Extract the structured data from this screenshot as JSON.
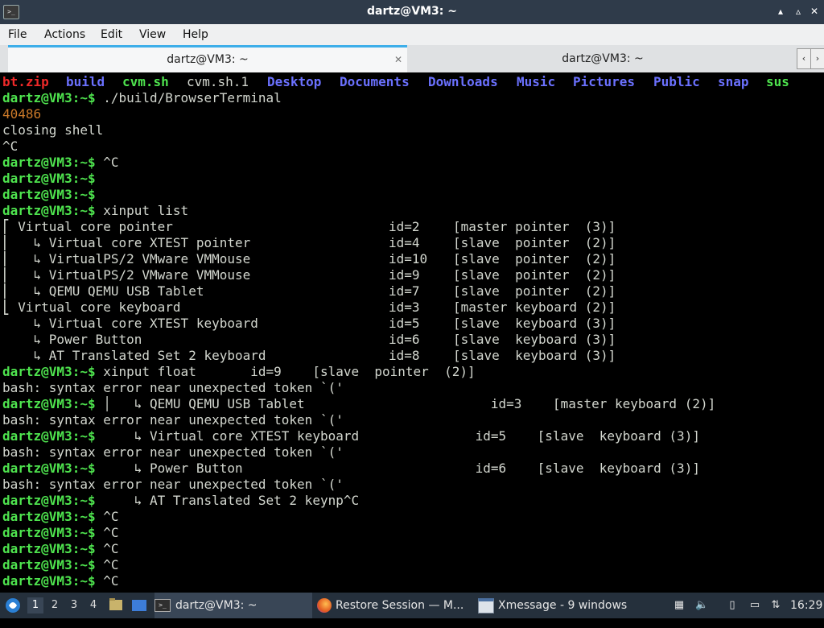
{
  "window": {
    "title": "dartz@VM3: ~",
    "minimize_glyph": "▴",
    "maximize_glyph": "▵",
    "close_glyph": "✕"
  },
  "menu": [
    "File",
    "Actions",
    "Edit",
    "View",
    "Help"
  ],
  "tabs": [
    {
      "label": "dartz@VM3: ~",
      "active": true,
      "close": "✕"
    },
    {
      "label": "dartz@VM3: ~",
      "active": false
    }
  ],
  "tab_nav": {
    "left": "‹",
    "right": "›"
  },
  "terminal": {
    "prompt": "dartz@VM3:~$",
    "ls_items": [
      {
        "text": "bt.zip",
        "color": "red"
      },
      {
        "text": "build",
        "color": "blue"
      },
      {
        "text": "cvm.sh",
        "color": "green"
      },
      {
        "text": "cvm.sh.1",
        "color": "white"
      },
      {
        "text": "Desktop",
        "color": "blue"
      },
      {
        "text": "Documents",
        "color": "blue"
      },
      {
        "text": "Downloads",
        "color": "blue"
      },
      {
        "text": "Music",
        "color": "blue"
      },
      {
        "text": "Pictures",
        "color": "blue"
      },
      {
        "text": "Public",
        "color": "blue"
      },
      {
        "text": "snap",
        "color": "blue"
      },
      {
        "text": "sus",
        "color": "green"
      }
    ],
    "lines": [
      {
        "prompt": true,
        "text": " ./build/BrowserTerminal"
      },
      {
        "prompt": false,
        "text": "40486",
        "color": "orange"
      },
      {
        "prompt": false,
        "text": "closing shell"
      },
      {
        "prompt": false,
        "text": "^C"
      },
      {
        "prompt": true,
        "text": " ^C"
      },
      {
        "prompt": true,
        "text": ""
      },
      {
        "prompt": true,
        "text": ""
      },
      {
        "prompt": true,
        "text": " xinput list"
      },
      {
        "prompt": false,
        "text": "⎡ Virtual core pointer                    \tid=2\t[master pointer  (3)]"
      },
      {
        "prompt": false,
        "text": "⎜   ↳ Virtual core XTEST pointer              \tid=4\t[slave  pointer  (2)]"
      },
      {
        "prompt": false,
        "text": "⎜   ↳ VirtualPS/2 VMware VMMouse              \tid=10\t[slave  pointer  (2)]"
      },
      {
        "prompt": false,
        "text": "⎜   ↳ VirtualPS/2 VMware VMMouse              \tid=9\t[slave  pointer  (2)]"
      },
      {
        "prompt": false,
        "text": "⎜   ↳ QEMU QEMU USB Tablet                    \tid=7\t[slave  pointer  (2)]"
      },
      {
        "prompt": false,
        "text": "⎣ Virtual core keyboard                   \tid=3\t[master keyboard (2)]"
      },
      {
        "prompt": false,
        "text": "    ↳ Virtual core XTEST keyboard             \tid=5\t[slave  keyboard (3)]"
      },
      {
        "prompt": false,
        "text": "    ↳ Power Button                            \tid=6\t[slave  keyboard (3)]"
      },
      {
        "prompt": false,
        "text": "    ↳ AT Translated Set 2 keyboard            \tid=8\t[slave  keyboard (3)]"
      },
      {
        "prompt": true,
        "text": " xinput float       id=9    [slave  pointer  (2)]"
      },
      {
        "prompt": false,
        "text": "bash: syntax error near unexpected token `('"
      },
      {
        "prompt": true,
        "text": " │   ↳ QEMU QEMU USB Tablet                        id=3    [master keyboard (2)]"
      },
      {
        "prompt": false,
        "text": "bash: syntax error near unexpected token `('"
      },
      {
        "prompt": true,
        "text": "     ↳ Virtual core XTEST keyboard               id=5    [slave  keyboard (3)]"
      },
      {
        "prompt": false,
        "text": "bash: syntax error near unexpected token `('"
      },
      {
        "prompt": true,
        "text": "     ↳ Power Button                              id=6    [slave  keyboard (3)]"
      },
      {
        "prompt": false,
        "text": "bash: syntax error near unexpected token `('"
      },
      {
        "prompt": true,
        "text": "     ↳ AT Translated Set 2 keynp^C"
      },
      {
        "prompt": true,
        "text": " ^C"
      },
      {
        "prompt": true,
        "text": " ^C"
      },
      {
        "prompt": true,
        "text": " ^C"
      },
      {
        "prompt": true,
        "text": " ^C"
      },
      {
        "prompt": true,
        "text": " ^C"
      }
    ]
  },
  "taskbar": {
    "workspaces": [
      "1",
      "2",
      "3",
      "4"
    ],
    "active_workspace": "1",
    "tasks": [
      {
        "label": "dartz@VM3: ~",
        "icon": "terminal-icon"
      },
      {
        "label": "Restore Session — M...",
        "icon": "firefox-icon"
      },
      {
        "label": "Xmessage - 9 windows",
        "icon": "window-icon"
      }
    ],
    "clock": "16:29"
  },
  "colors": {
    "prompt": "#4ee34e",
    "dir": "#6b71ff",
    "archive": "#ef2929",
    "pid": "#cc7a29",
    "tab_accent": "#3daee9"
  }
}
